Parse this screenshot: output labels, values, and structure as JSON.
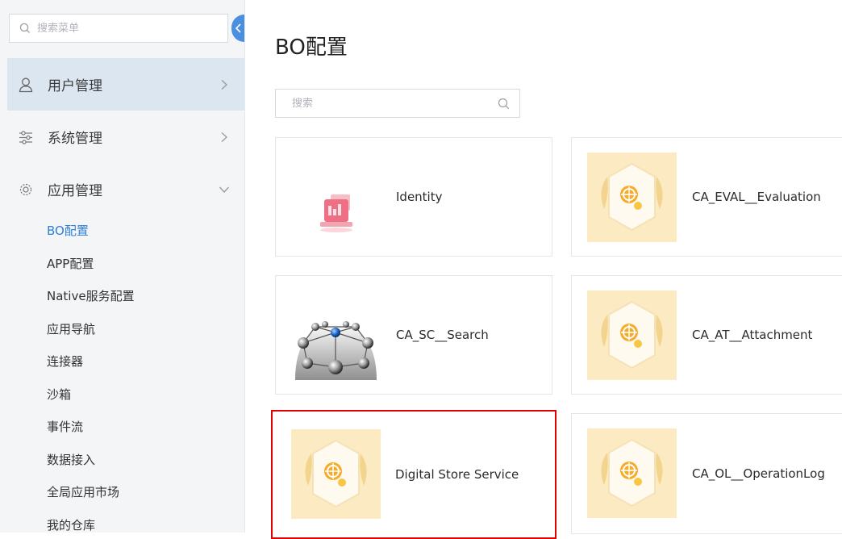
{
  "sidebar": {
    "search_placeholder": "搜索菜单",
    "groups": [
      {
        "label": "用户管理",
        "icon": "user-icon"
      },
      {
        "label": "系统管理",
        "icon": "sliders-icon"
      },
      {
        "label": "应用管理",
        "icon": "gear-icon"
      }
    ],
    "sub_items": [
      "BO配置",
      "APP配置",
      "Native服务配置",
      "应用导航",
      "连接器",
      "沙箱",
      "事件流",
      "数据接入",
      "全局应用市场",
      "我的仓库"
    ],
    "active_sub_item": "BO配置"
  },
  "main": {
    "title": "BO配置",
    "search_placeholder": "搜索",
    "cards": [
      {
        "name": "Identity",
        "icon": "identity-icon"
      },
      {
        "name": "CA_EVAL__Evaluation",
        "icon": "hexagon-badge-icon"
      },
      {
        "name": "CA_SC__Search",
        "icon": "network-sphere-icon"
      },
      {
        "name": "CA_AT__Attachment",
        "icon": "hexagon-badge-icon"
      },
      {
        "name": "Digital Store Service",
        "icon": "hexagon-badge-icon",
        "highlighted": true
      },
      {
        "name": "CA_OL__OperationLog",
        "icon": "hexagon-badge-icon"
      }
    ]
  },
  "colors": {
    "accent": "#2f7fd8",
    "collapse_tab": "#4a8fe0",
    "active_group_bg": "#dbe6f1",
    "highlight_border": "#e00000",
    "thumb_bg": "#fbeac2"
  }
}
